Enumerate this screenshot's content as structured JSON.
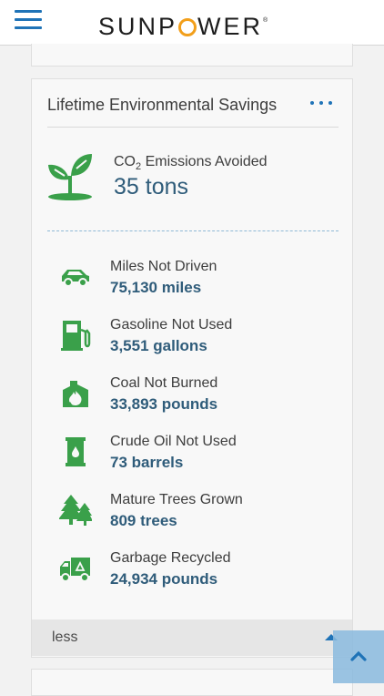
{
  "header": {
    "brand_prefix": "SUNP",
    "brand_suffix": "WER",
    "brand_mark": "®",
    "menu_icon": "hamburger-menu-icon",
    "accent_color": "#1f73b7",
    "logo_o_color": "#f29f1b"
  },
  "card": {
    "title": "Lifetime Environmental Savings",
    "more_icon": "more-dots-icon"
  },
  "co2": {
    "label_prefix": "CO",
    "label_sub": "2",
    "label_suffix": " Emissions Avoided",
    "value": "35 tons",
    "icon": "sprout-plant-icon",
    "icon_color": "#3aa04a"
  },
  "metrics": [
    {
      "label": "Miles Not Driven",
      "value": "75,130 miles",
      "icon": "car-icon"
    },
    {
      "label": "Gasoline Not Used",
      "value": "3,551 gallons",
      "icon": "gas-pump-icon"
    },
    {
      "label": "Coal Not Burned",
      "value": "33,893 pounds",
      "icon": "coal-fire-icon"
    },
    {
      "label": "Crude Oil Not Used",
      "value": "73 barrels",
      "icon": "oil-barrel-icon"
    },
    {
      "label": "Mature Trees Grown",
      "value": "809 trees",
      "icon": "trees-icon"
    },
    {
      "label": "Garbage Recycled",
      "value": "24,934 pounds",
      "icon": "recycling-truck-icon"
    }
  ],
  "footer": {
    "less_label": "less",
    "collapse_icon": "caret-up-icon",
    "scroll_top_icon": "chevron-up-icon"
  },
  "colors": {
    "value_text": "#2f5c7a",
    "icon_green": "#3aa04a"
  }
}
